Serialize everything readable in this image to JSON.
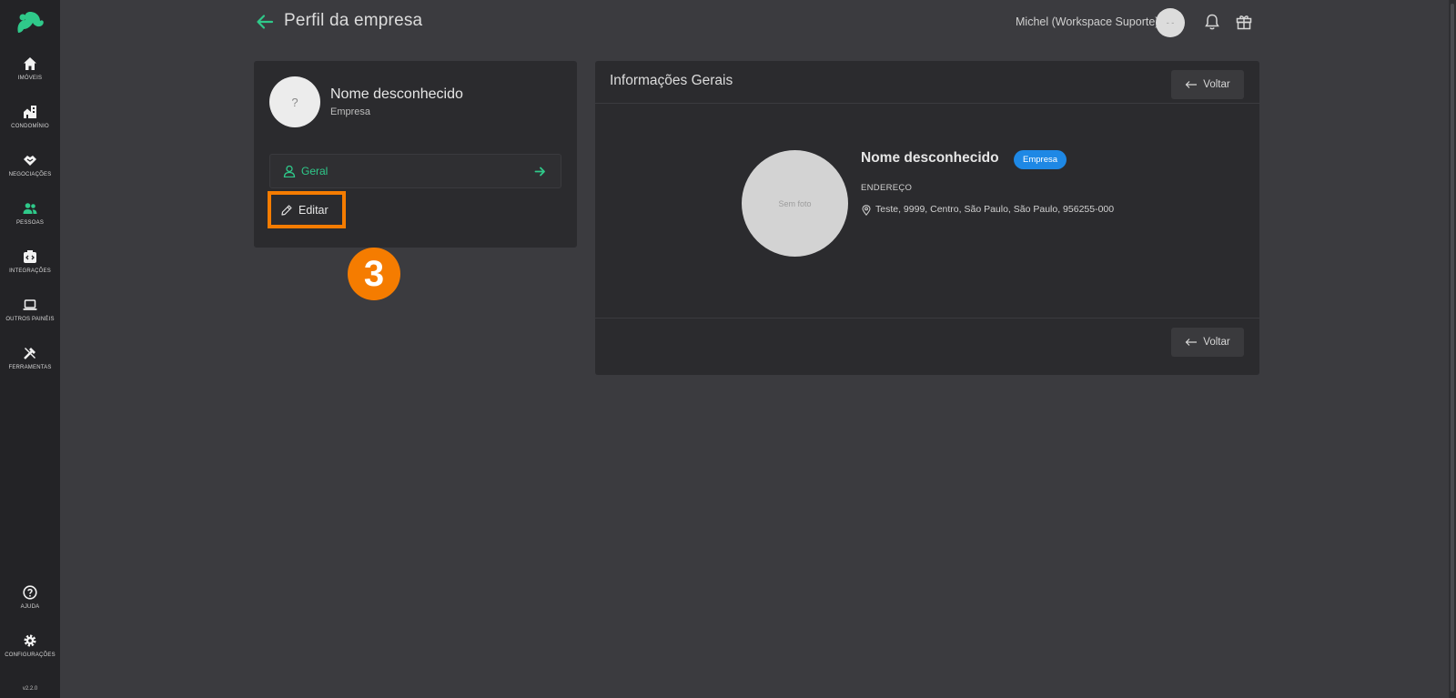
{
  "sidebar": {
    "items": [
      {
        "label": "Imóveis",
        "icon": "home-icon"
      },
      {
        "label": "Condomínio",
        "icon": "building-icon"
      },
      {
        "label": "Negociações",
        "icon": "handshake-icon"
      },
      {
        "label": "Pessoas",
        "icon": "people-icon"
      },
      {
        "label": "Integrações",
        "icon": "plug-icon"
      },
      {
        "label": "Outros painéis",
        "icon": "laptop-icon"
      },
      {
        "label": "Ferramentas",
        "icon": "tools-icon"
      }
    ],
    "bottom_items": [
      {
        "label": "Ajuda",
        "icon": "help-icon"
      },
      {
        "label": "Configurações",
        "icon": "gear-icon"
      }
    ],
    "version": "v2.2.0"
  },
  "header": {
    "title": "Perfil da empresa",
    "user_name": "Michel (Workspace Suporte)",
    "avatar_text": "- -"
  },
  "profile_card": {
    "avatar_text": "?",
    "name": "Nome desconhecido",
    "type": "Empresa",
    "menu_item": "Geral",
    "edit_label": "Editar"
  },
  "step_badge": "3",
  "info_card": {
    "title": "Informações Gerais",
    "back_label": "Voltar",
    "photo_text": "Sem foto",
    "name": "Nome desconhecido",
    "badge": "Empresa",
    "address_label": "ENDEREÇO",
    "address": "Teste, 9999, Centro, São Paulo, São Paulo, 956255-000",
    "footer_back_label": "Voltar"
  },
  "colors": {
    "accent_green": "#2fc98a",
    "highlight_orange": "#f57c00",
    "badge_blue": "#1e88e5"
  }
}
